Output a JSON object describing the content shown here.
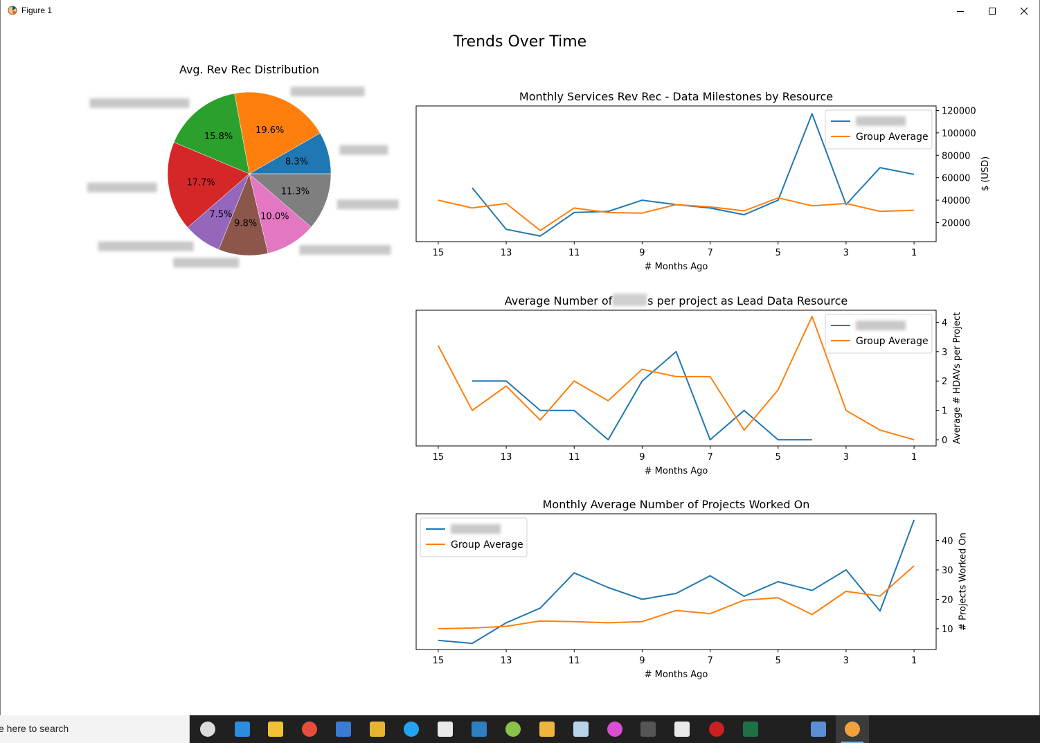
{
  "window": {
    "title": "Figure 1"
  },
  "figure": {
    "suptitle": "Trends Over Time"
  },
  "chart_data": [
    {
      "type": "pie",
      "title": "Avg. Rev Rec Distribution",
      "slices": [
        {
          "label": "",
          "value": 8.3,
          "pct_label": "8.3%",
          "color": "#1f77b4"
        },
        {
          "label": "",
          "value": 19.6,
          "pct_label": "19.6%",
          "color": "#ff7f0e"
        },
        {
          "label": "",
          "value": 15.8,
          "pct_label": "15.8%",
          "color": "#2ca02c"
        },
        {
          "label": "",
          "value": 17.7,
          "pct_label": "17.7%",
          "color": "#d62728"
        },
        {
          "label": "",
          "value": 7.5,
          "pct_label": "7.5%",
          "color": "#9467bd"
        },
        {
          "label": "",
          "value": 9.8,
          "pct_label": "9.8%",
          "color": "#8c564b"
        },
        {
          "label": "",
          "value": 10.0,
          "pct_label": "10.0%",
          "color": "#e377c2"
        },
        {
          "label": "",
          "value": 11.3,
          "pct_label": "11.3%",
          "color": "#7f7f7f"
        }
      ]
    },
    {
      "type": "line",
      "title": "Monthly Services Rev Rec - Data Milestones by Resource",
      "xlabel": "# Months Ago",
      "ylabel": "$ (USD)",
      "xlim": [
        15.65,
        0.35
      ],
      "ylim": [
        3000,
        124000
      ],
      "xticks": [
        15,
        13,
        11,
        9,
        7,
        5,
        3,
        1
      ],
      "yticks": [
        20000,
        40000,
        60000,
        80000,
        100000,
        120000
      ],
      "legend": "upper right",
      "series": [
        {
          "name": "",
          "color": "#1f77b4",
          "x": [
            14,
            13,
            12,
            11,
            10,
            9,
            8,
            7,
            6,
            5,
            4,
            3,
            2,
            1
          ],
          "y": [
            51000,
            14000,
            8000,
            29000,
            30000,
            40000,
            36000,
            33000,
            27000,
            40000,
            117000,
            36000,
            69000,
            63000
          ]
        },
        {
          "name": "Group Average",
          "color": "#ff7f0e",
          "x": [
            15,
            14,
            13,
            12,
            11,
            10,
            9,
            8,
            7,
            6,
            5,
            4,
            3,
            2,
            1
          ],
          "y": [
            40000,
            33000,
            37000,
            13000,
            33000,
            29000,
            28500,
            36000,
            34000,
            30500,
            42000,
            35000,
            37000,
            30000,
            31000
          ]
        }
      ]
    },
    {
      "type": "line",
      "title_parts": [
        "Average Number of ",
        "s per project as Lead Data Resource"
      ],
      "xlabel": "# Months Ago",
      "ylabel": "Average # HDAVs per Project",
      "xlim": [
        15.65,
        0.35
      ],
      "ylim": [
        -0.21,
        4.41
      ],
      "xticks": [
        15,
        13,
        11,
        9,
        7,
        5,
        3,
        1
      ],
      "yticks": [
        0,
        1,
        2,
        3,
        4
      ],
      "legend": "upper right",
      "series": [
        {
          "name": "",
          "color": "#1f77b4",
          "x": [
            14,
            13,
            12,
            11,
            10,
            9,
            8,
            7,
            6,
            5,
            4
          ],
          "y": [
            2,
            2,
            1,
            1,
            0,
            2,
            3,
            0,
            1,
            0,
            0
          ]
        },
        {
          "name": "Group Average",
          "color": "#ff7f0e",
          "x": [
            15,
            14,
            13,
            12,
            11,
            10,
            9,
            8,
            7,
            6,
            5,
            4,
            3,
            2,
            1
          ],
          "y": [
            3.2,
            1.0,
            1.83,
            0.67,
            2.0,
            1.33,
            2.4,
            2.15,
            2.15,
            0.33,
            1.7,
            4.2,
            1.0,
            0.33,
            0.0
          ]
        }
      ]
    },
    {
      "type": "line",
      "title": "Monthly Average Number of Projects Worked On",
      "xlabel": "# Months Ago",
      "ylabel": "# Projects Worked On",
      "xlim": [
        15.65,
        0.35
      ],
      "ylim": [
        2.9,
        49.1
      ],
      "xticks": [
        15,
        13,
        11,
        9,
        7,
        5,
        3,
        1
      ],
      "yticks": [
        10,
        20,
        30,
        40
      ],
      "legend": "upper left",
      "series": [
        {
          "name": "",
          "color": "#1f77b4",
          "x": [
            15,
            14,
            13,
            12,
            11,
            10,
            9,
            8,
            7,
            6,
            5,
            4,
            3,
            2,
            1
          ],
          "y": [
            6,
            5,
            12,
            17,
            29,
            24,
            20,
            22,
            28,
            21,
            26,
            23,
            30,
            16,
            47
          ]
        },
        {
          "name": "Group Average",
          "color": "#ff7f0e",
          "x": [
            15,
            14,
            13,
            12,
            11,
            10,
            9,
            8,
            7,
            6,
            5,
            4,
            3,
            2,
            1
          ],
          "y": [
            10,
            10.2,
            10.8,
            12.6,
            12.4,
            12.0,
            12.4,
            16.2,
            15.1,
            19.7,
            20.5,
            14.8,
            22.7,
            21.1,
            31.4
          ]
        }
      ]
    }
  ],
  "taskbar": {
    "search_text": "e here to search",
    "icons": [
      "task-view-icon",
      "edge-icon",
      "file-explorer-icon",
      "chrome-icon",
      "network-app-icon",
      "tools-app-icon",
      "vscode-icon",
      "chat-app-icon",
      "s-app-icon",
      "notepad-app-icon",
      "folder-person-icon",
      "eraser-app-icon",
      "datagrip-icon",
      "terminal-icon",
      "chat-app-2-icon",
      "red-app-icon",
      "excel-icon",
      "people-app-icon",
      "matplotlib-figure-icon"
    ]
  }
}
